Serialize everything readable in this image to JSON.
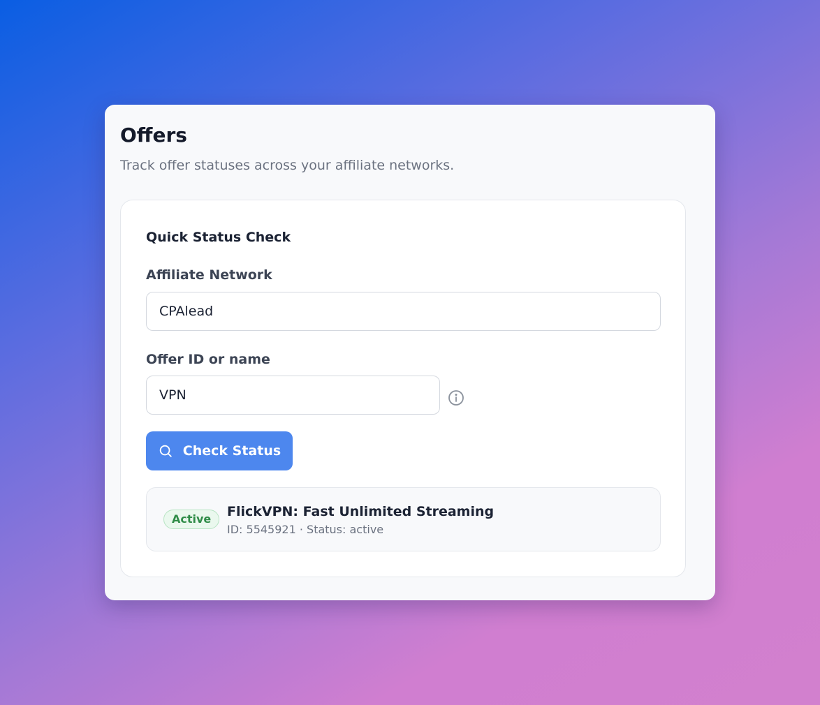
{
  "header": {
    "title": "Offers",
    "subtitle": "Track offer statuses across your affiliate networks."
  },
  "quick_check": {
    "title": "Quick Status Check",
    "network_label": "Affiliate Network",
    "network_value": "CPAlead",
    "offer_label": "Offer ID or name",
    "offer_value": "VPN",
    "info_icon": "info-circle-icon",
    "button_label": "Check Status",
    "button_icon": "search-icon"
  },
  "result": {
    "badge": "Active",
    "name": "FlickVPN: Fast Unlimited Streaming",
    "meta": "ID: 5545921 · Status: active"
  },
  "colors": {
    "accent": "#4d87ee",
    "success": "#2f8c48",
    "success_bg": "#eaf8ee"
  }
}
